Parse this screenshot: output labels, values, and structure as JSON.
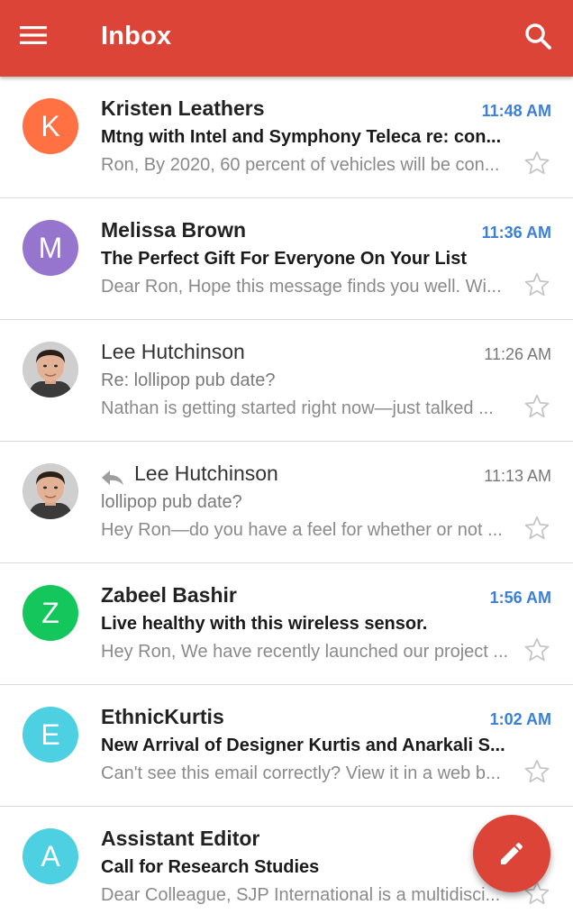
{
  "appbar": {
    "title": "Inbox",
    "background_color": "#db4437",
    "menu_icon": "hamburger-menu-icon",
    "search_icon": "search-icon"
  },
  "emails": [
    {
      "sender": "Kristen Leathers",
      "time": "11:48 AM",
      "subject": "Mtng with Intel and Symphony Teleca re: con...",
      "snippet": "Ron, By 2020, 60 percent of vehicles will be con...",
      "unread": true,
      "avatar_letter": "K",
      "avatar_color": "#ff7043",
      "starred": false
    },
    {
      "sender": "Melissa Brown",
      "time": "11:36 AM",
      "subject": "The Perfect Gift For Everyone On Your List",
      "snippet": "Dear Ron, Hope this message finds you well. Wi...",
      "unread": true,
      "avatar_letter": "M",
      "avatar_color": "#9575cd",
      "starred": false
    },
    {
      "sender": "Lee Hutchinson",
      "time": "11:26 AM",
      "subject": "Re: lollipop pub date?",
      "snippet": "Nathan is getting started right now—just talked ...",
      "unread": false,
      "avatar_photo": "profile-photo",
      "starred": false
    },
    {
      "sender": "Lee Hutchinson",
      "time": "11:13 AM",
      "subject": "lollipop pub date?",
      "snippet": "Hey Ron—do you have a feel for whether or not ...",
      "unread": false,
      "replied": true,
      "avatar_photo": "profile-photo",
      "starred": false
    },
    {
      "sender": "Zabeel Bashir",
      "time": "1:56 AM",
      "subject": "Live healthy with this wireless sensor.",
      "snippet": "Hey Ron, We have recently launched our project ...",
      "unread": true,
      "avatar_letter": "Z",
      "avatar_color": "#14c75c",
      "starred": false
    },
    {
      "sender": "EthnicKurtis",
      "time": "1:02 AM",
      "subject": "New Arrival of Designer Kurtis and Anarkali S...",
      "snippet": "Can't see this email correctly? View it in a web b...",
      "unread": true,
      "avatar_letter": "E",
      "avatar_color": "#4dd0e1",
      "starred": false
    },
    {
      "sender": "Assistant Editor",
      "time": "",
      "subject": "Call for Research Studies",
      "snippet": "Dear Colleague, SJP International is a multidisci...",
      "unread": true,
      "avatar_letter": "A",
      "avatar_color": "#4dd0e1",
      "starred": false
    }
  ],
  "fab": {
    "icon": "pencil-compose-icon",
    "color": "#db4437"
  },
  "colors": {
    "unread_time": "#3b7fd9",
    "read_time": "#777777"
  }
}
